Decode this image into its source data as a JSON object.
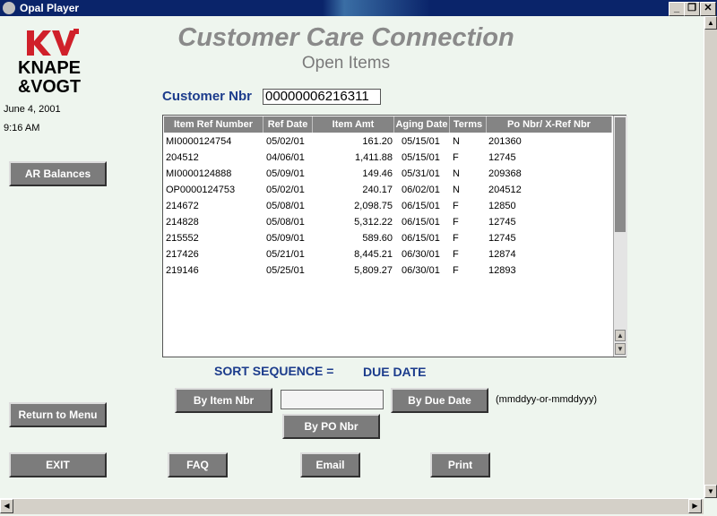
{
  "window": {
    "title": "Opal Player",
    "minimize": "_",
    "restore": "❐",
    "close": "✕"
  },
  "logo": {
    "kv": "KV",
    "line1": "KNAPE",
    "line2": "&VOGT"
  },
  "date": "June 4, 2001",
  "time": "9:16 AM",
  "header": {
    "title": "Customer Care Connection",
    "subtitle": "Open Items"
  },
  "customer": {
    "label": "Customer Nbr",
    "value": "00000006216311"
  },
  "table": {
    "columns": [
      "Item Ref Number",
      "Ref Date",
      "Item Amt",
      "Aging Date",
      "Terms",
      "Po Nbr/ X-Ref Nbr"
    ],
    "rows": [
      [
        "MI0000124754",
        "05/02/01",
        "161.20",
        "05/15/01",
        "N",
        "201360"
      ],
      [
        "204512",
        "04/06/01",
        "1,411.88",
        "05/15/01",
        "F",
        "12745"
      ],
      [
        "MI0000124888",
        "05/09/01",
        "149.46",
        "05/31/01",
        "N",
        "209368"
      ],
      [
        "OP0000124753",
        "05/02/01",
        "240.17",
        "06/02/01",
        "N",
        "204512"
      ],
      [
        "214672",
        "05/08/01",
        "2,098.75",
        "06/15/01",
        "F",
        "12850"
      ],
      [
        "214828",
        "05/08/01",
        "5,312.22",
        "06/15/01",
        "F",
        "12745"
      ],
      [
        "215552",
        "05/09/01",
        "589.60",
        "06/15/01",
        "F",
        "12745"
      ],
      [
        "217426",
        "05/21/01",
        "8,445.21",
        "06/30/01",
        "F",
        "12874"
      ],
      [
        "219146",
        "05/25/01",
        "5,809.27",
        "06/30/01",
        "F",
        "12893"
      ]
    ]
  },
  "sort": {
    "label": "SORT SEQUENCE =",
    "value": "DUE DATE"
  },
  "buttons": {
    "ar_balances": "AR Balances",
    "return_to_menu": "Return to Menu",
    "by_item_nbr": "By Item Nbr",
    "by_due_date": "By Due Date",
    "by_po_nbr": "By PO Nbr",
    "exit": "EXIT",
    "faq": "FAQ",
    "email": "Email",
    "print": "Print"
  },
  "date_hint": "(mmddyy-or-mmddyyy)",
  "colors": {
    "title_bar": "#0a246a",
    "label_blue": "#1c3c8c",
    "button_gray": "#7c7c7c",
    "background": "#eef5ee",
    "logo_red": "#d0202a"
  }
}
